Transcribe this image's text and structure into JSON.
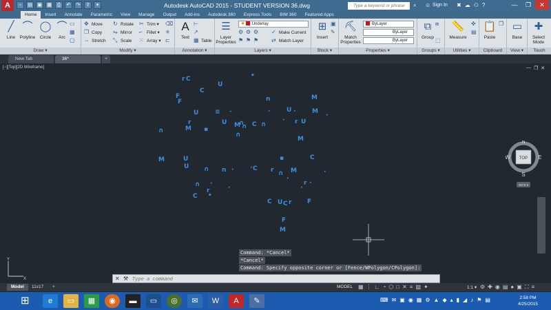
{
  "title_bar": {
    "app_logo": "A",
    "title": "Autodesk AutoCAD 2015 - STUDENT VERSION     36.dwg",
    "search_placeholder": "Type a keyword or phrase",
    "sign_in": "Sign In"
  },
  "ribbon_tabs": [
    "Home",
    "Insert",
    "Annotate",
    "Parametric",
    "View",
    "Manage",
    "Output",
    "Add-ins",
    "Autodesk 360",
    "Express Tools",
    "BIM 360",
    "Featured Apps"
  ],
  "ribbon": {
    "draw": {
      "line": "Line",
      "polyline": "Polyline",
      "circle": "Circle",
      "arc": "Arc",
      "footer": "Draw ▾"
    },
    "modify": {
      "move": "Move",
      "rotate": "Rotate",
      "trim": "Trim ▾",
      "copy": "Copy",
      "mirror": "Mirror",
      "fillet": "Fillet ▾",
      "stretch": "Stretch",
      "scale": "Scale",
      "array": "Array ▾",
      "footer": "Modify ▾"
    },
    "annotation": {
      "text": "Text",
      "table": "Table",
      "footer": "Annotation ▾"
    },
    "layers": {
      "layer_properties": "Layer Properties",
      "layer_combo": "Underlay",
      "make_current": "Make Current",
      "match_layer": "Match Layer",
      "footer": "Layers ▾"
    },
    "block": {
      "insert": "Insert",
      "footer": "Block ▾"
    },
    "properties": {
      "match_properties": "Match Properties",
      "color": "ByLayer",
      "linetype": "ByLayer",
      "lineweight": "ByLayer",
      "footer": "Properties ▾"
    },
    "groups": {
      "group": "Group",
      "footer": "Groups ▾"
    },
    "utilities": {
      "measure": "Measure",
      "footer": "Utilities ▾"
    },
    "clipboard": {
      "paste": "Paste",
      "footer": "Clipboard"
    },
    "view": {
      "base": "Base",
      "footer": "View ▾"
    },
    "touch": {
      "select_mode": "Select Mode",
      "footer": "Touch"
    }
  },
  "file_tabs": [
    "New Tab",
    "36*"
  ],
  "viewport": {
    "label": "[−][Top][2D Wireframe]",
    "viewcube": {
      "face": "TOP",
      "n": "N",
      "s": "S",
      "e": "E",
      "w": "W",
      "wcs": "WCS ▾"
    },
    "glyphs": [
      "•",
      "r",
      "C",
      "U",
      "C",
      "F",
      "F",
      "M",
      "n",
      "U",
      "≡",
      "·",
      "·",
      "U",
      "·",
      "M",
      "·",
      "·",
      "r",
      "U",
      "r",
      "U",
      "∩",
      "M",
      "C",
      "∩",
      "∩",
      "▪",
      "∩",
      "M",
      "∩",
      "M",
      "▪",
      "C",
      "M",
      "U",
      "U",
      "∩",
      "n",
      "·",
      "·",
      "C",
      "r",
      "M",
      "∩",
      "·",
      "·",
      "·",
      "r",
      "·",
      "∩",
      "·",
      "·",
      "r",
      "C"
    ]
  },
  "command": {
    "history": [
      "Command: *Cancel*",
      "*Cancel*",
      "Command: Specify opposite corner or [Fence/WPolygon/CPolygon]:"
    ],
    "placeholder": "Type a command"
  },
  "layout_tabs": [
    "Model",
    "11x17",
    "+"
  ],
  "status": {
    "space": "MODEL",
    "scale": "1:1 ▾"
  },
  "taskbar": {
    "time": "2:58 PM",
    "date": "4/25/2015"
  },
  "colors": {
    "drawing_blue": "#3d8fe0",
    "background": "#212830"
  }
}
